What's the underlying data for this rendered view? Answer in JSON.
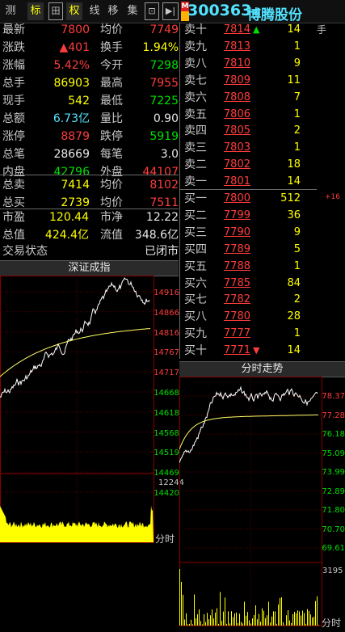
{
  "toolbar": {
    "items": [
      "测",
      "标",
      "田",
      "权",
      "线",
      "移",
      "集",
      "⊡",
      "▶|"
    ]
  },
  "stock": {
    "code": "300363",
    "name": "博腾股份",
    "m_badge": "M"
  },
  "quote": {
    "latest_lbl": "最新",
    "latest": "7800",
    "avg_lbl": "均价",
    "avg": "7749",
    "change_lbl": "涨跌",
    "change": "▲401",
    "turnover_lbl": "换手",
    "turnover": "1.94%",
    "pct_lbl": "涨幅",
    "pct": "5.42%",
    "open_lbl": "今开",
    "open": "7298",
    "volume_lbl": "总手",
    "volume": "86903",
    "high_lbl": "最高",
    "high": "7955",
    "cur_lbl": "现手",
    "cur": "542",
    "low_lbl": "最低",
    "low": "7225",
    "amount_lbl": "总额",
    "amount": "6.73亿",
    "ratio_lbl": "量比",
    "ratio": "0.90",
    "limit_up_lbl": "涨停",
    "limit_up": "8879",
    "limit_down_lbl": "跌停",
    "limit_down": "5919",
    "trades_lbl": "总笔",
    "trades": "28669",
    "per_trade_lbl": "每笔",
    "per_trade": "3.0",
    "inner_lbl": "内盘",
    "inner": "42796",
    "outer_lbl": "外盘",
    "outer": "44107",
    "total_sell_lbl": "总卖",
    "total_sell": "7414",
    "sell_avg_lbl": "均价",
    "sell_avg": "8102",
    "total_buy_lbl": "总买",
    "total_buy": "2739",
    "buy_avg_lbl": "均价",
    "buy_avg": "7511",
    "pe_lbl": "市盈",
    "pe": "120.44",
    "pb_lbl": "市净",
    "pb": "12.22",
    "mcap_lbl": "总值",
    "mcap": "424.4亿",
    "float_lbl": "流值",
    "float": "348.6亿",
    "status_lbl": "交易状态",
    "status": "已闭市"
  },
  "asks": [
    {
      "label": "卖十",
      "price": "7814",
      "vol": "14"
    },
    {
      "label": "卖九",
      "price": "7813",
      "vol": "1"
    },
    {
      "label": "卖八",
      "price": "7810",
      "vol": "9"
    },
    {
      "label": "卖七",
      "price": "7809",
      "vol": "11"
    },
    {
      "label": "卖六",
      "price": "7808",
      "vol": "7"
    },
    {
      "label": "卖五",
      "price": "7806",
      "vol": "1"
    },
    {
      "label": "卖四",
      "price": "7805",
      "vol": "2"
    },
    {
      "label": "卖三",
      "price": "7803",
      "vol": "1"
    },
    {
      "label": "卖二",
      "price": "7802",
      "vol": "18"
    },
    {
      "label": "卖一",
      "price": "7801",
      "vol": "14"
    }
  ],
  "bids": [
    {
      "label": "买一",
      "price": "7800",
      "vol": "512"
    },
    {
      "label": "买二",
      "price": "7799",
      "vol": "36"
    },
    {
      "label": "买三",
      "price": "7790",
      "vol": "9"
    },
    {
      "label": "买四",
      "price": "7789",
      "vol": "5"
    },
    {
      "label": "买五",
      "price": "7788",
      "vol": "1"
    },
    {
      "label": "买六",
      "price": "7785",
      "vol": "84"
    },
    {
      "label": "买七",
      "price": "7782",
      "vol": "2"
    },
    {
      "label": "买八",
      "price": "7780",
      "vol": "28"
    },
    {
      "label": "买九",
      "price": "7777",
      "vol": "1"
    },
    {
      "label": "买十",
      "price": "7771",
      "vol": "14"
    }
  ],
  "side_note": {
    "shou": "手",
    "plus16": "+16"
  },
  "index_panel": {
    "title": "深证成指",
    "y_labels": [
      "14916",
      "14866",
      "14816",
      "14767",
      "14717",
      "14668",
      "14618",
      "14568",
      "14519",
      "14469",
      "14420"
    ],
    "vol_label": "12244",
    "footer": "分时"
  },
  "intraday_panel": {
    "title": "分时走势",
    "y_labels": [
      "78.37",
      "77.28",
      "76.18",
      "75.09",
      "73.99",
      "72.89",
      "71.80",
      "70.70",
      "69.61"
    ],
    "vol_label": "3195",
    "footer": "分时"
  },
  "colors": {
    "up": "#ff3c3c",
    "down": "#00e000",
    "grid": "#8a0000",
    "avg_line": "#ffff66",
    "vol": "#ffff00"
  }
}
